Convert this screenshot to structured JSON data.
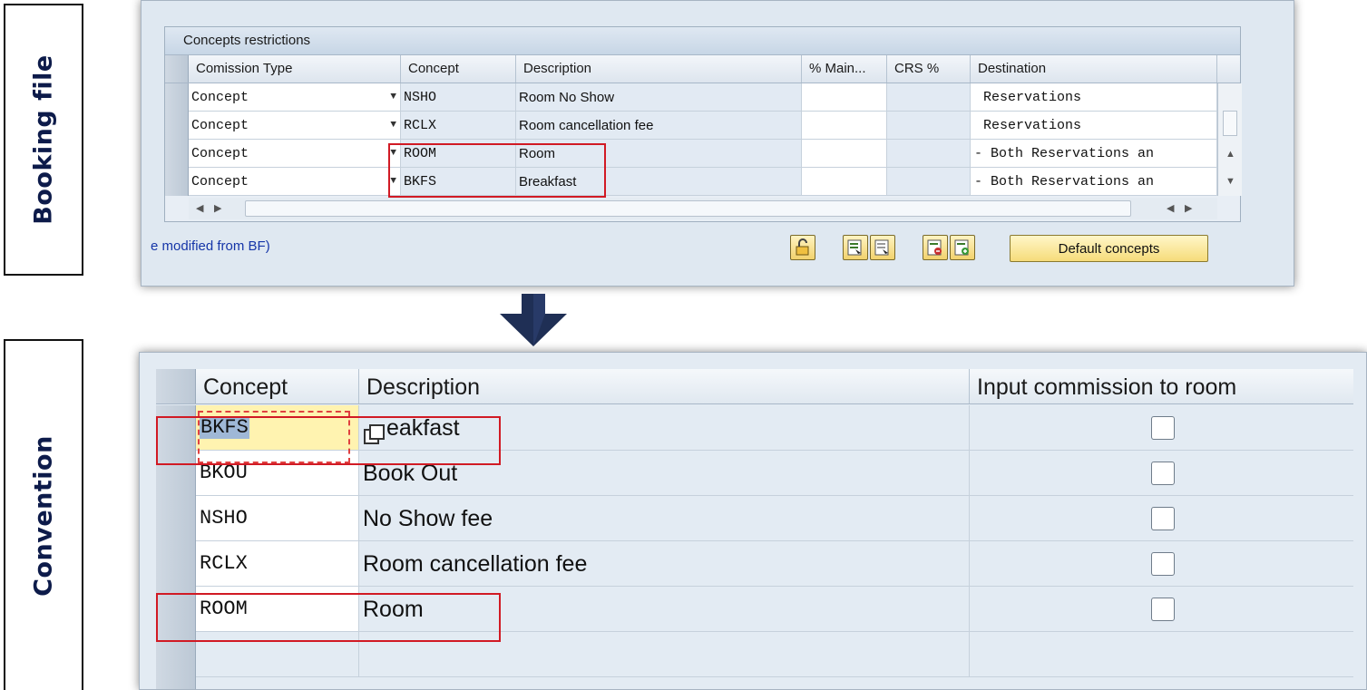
{
  "side_labels": {
    "top": "Booking file",
    "bottom": "Convention"
  },
  "top_panel": {
    "table_title": "Concepts restrictions",
    "columns": [
      "Comission Type",
      "Concept",
      "Description",
      "% Main...",
      "CRS %",
      "Destination"
    ],
    "rows": [
      {
        "type": "Concept",
        "concept": "NSHO",
        "description": "Room No Show",
        "main": "",
        "crs": "",
        "destination": "Reservations"
      },
      {
        "type": "Concept",
        "concept": "RCLX",
        "description": "Room cancellation fee",
        "main": "",
        "crs": "",
        "destination": "Reservations"
      },
      {
        "type": "Concept",
        "concept": "ROOM",
        "description": "Room",
        "main": "",
        "crs": "",
        "destination": "- Both Reservations an"
      },
      {
        "type": "Concept",
        "concept": "BKFS",
        "description": "Breakfast",
        "main": "",
        "crs": "",
        "destination": "- Both Reservations an"
      }
    ],
    "footer_note": "e modified from BF)",
    "default_button": "Default concepts",
    "icons": [
      "unlock-icon",
      "select-all-icon",
      "deselect-all-icon",
      "delete-row-icon",
      "insert-row-icon"
    ]
  },
  "bottom_panel": {
    "columns": [
      "Concept",
      "Description",
      "Input commission to room"
    ],
    "rows": [
      {
        "concept": "BKFS",
        "description": "eakfast",
        "checked": false
      },
      {
        "concept": "BKOU",
        "description": "Book Out",
        "checked": false
      },
      {
        "concept": "NSHO",
        "description": "No Show fee",
        "checked": false
      },
      {
        "concept": "RCLX",
        "description": "Room cancellation fee",
        "checked": false
      },
      {
        "concept": "ROOM",
        "description": "Room",
        "checked": false
      }
    ]
  },
  "colors": {
    "highlight": "#d11a24",
    "arrow": "#1f2f55",
    "label_text": "#0d1b4a"
  }
}
